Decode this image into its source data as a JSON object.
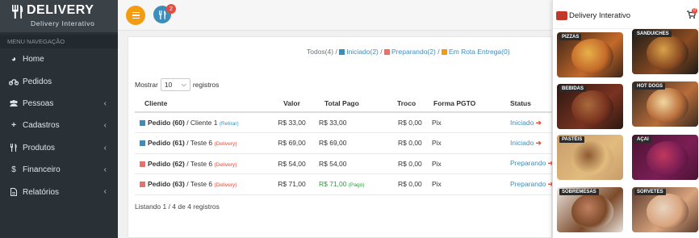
{
  "brand": {
    "title": "DELIVERY",
    "subtitle": "Delivery Interativo"
  },
  "sidebar": {
    "header": "MENU NAVEGAÇÃO",
    "items": [
      {
        "label": "Home",
        "icon": "dashboard-icon",
        "chevron": false
      },
      {
        "label": "Pedidos",
        "icon": "motorcycle-icon",
        "chevron": false
      },
      {
        "label": "Pessoas",
        "icon": "users-icon",
        "chevron": true
      },
      {
        "label": "Cadastros",
        "icon": "plus-icon",
        "chevron": true
      },
      {
        "label": "Produtos",
        "icon": "cutlery-icon",
        "chevron": true
      },
      {
        "label": "Financeiro",
        "icon": "dollar-icon",
        "chevron": true
      },
      {
        "label": "Relatórios",
        "icon": "file-icon",
        "chevron": true
      }
    ]
  },
  "topbar": {
    "cart_count": "2"
  },
  "filters": {
    "all": "Todos(4)",
    "sep": "/",
    "started": "Iniciado(2)",
    "preparing": "Preparando(2)",
    "delivering": "Em Rota Entrega(0)",
    "colors": {
      "started": "#3c8dbc",
      "preparing": "#e8726a",
      "delivering": "#f39c12"
    }
  },
  "table_controls": {
    "show_label": "Mostrar",
    "page_size": "10",
    "records_label": "registros"
  },
  "table": {
    "headers": [
      "Cliente",
      "Valor",
      "Total Pago",
      "Troco",
      "Forma PGTO",
      "Status"
    ],
    "rows": [
      {
        "order": "Pedido (60)",
        "client": "/ Cliente 1",
        "tag": "(Retirar)",
        "tag_color": "#3c8dbc",
        "dot": "#3c8dbc",
        "valor": "R$ 33,00",
        "pago": "R$ 33,00",
        "pago_note": "",
        "troco": "R$ 0,00",
        "forma": "Pix",
        "status": "Iniciado"
      },
      {
        "order": "Pedido (61)",
        "client": "/ Teste 6",
        "tag": "(Delivery)",
        "tag_color": "#e74c3c",
        "dot": "#3c8dbc",
        "valor": "R$ 69,00",
        "pago": "R$ 69,00",
        "pago_note": "",
        "troco": "R$ 0,00",
        "forma": "Pix",
        "status": "Iniciado"
      },
      {
        "order": "Pedido (62)",
        "client": "/ Teste 6",
        "tag": "(Delivery)",
        "tag_color": "#e74c3c",
        "dot": "#e8726a",
        "valor": "R$ 54,00",
        "pago": "R$ 54,00",
        "pago_note": "",
        "troco": "R$ 0,00",
        "forma": "Pix",
        "status": "Preparando"
      },
      {
        "order": "Pedido (63)",
        "client": "/ Teste 6",
        "tag": "(Delivery)",
        "tag_color": "#e74c3c",
        "dot": "#e8726a",
        "valor": "R$ 71,00",
        "pago": "R$ 71,00",
        "pago_note": "(Pago)",
        "troco": "R$ 0,00",
        "forma": "Pix",
        "status": "Preparando"
      }
    ]
  },
  "footer": "Listando 1 / 4 de 4 registros",
  "panel": {
    "title": "Delivery Interativo",
    "cart_count": "0",
    "categories": [
      "PIZZAS",
      "SANDUICHES",
      "BEBIDAS",
      "HOT DOGS",
      "PASTÉIS",
      "AÇAI",
      "SOBREMESAS",
      "SORVETES"
    ]
  }
}
